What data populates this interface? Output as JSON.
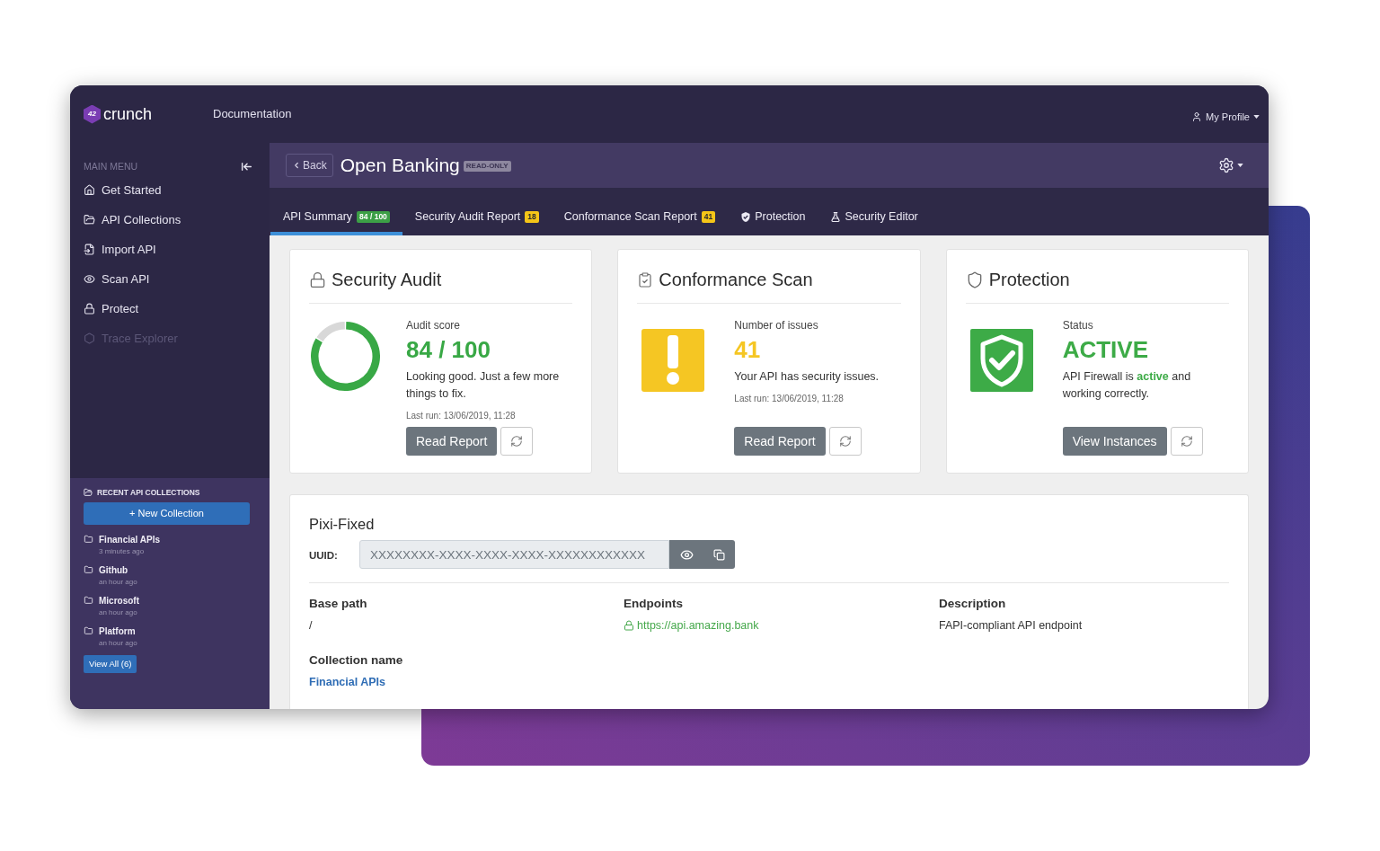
{
  "topbar": {
    "logo": {
      "mark": "42",
      "name": "crunch"
    },
    "nav_link": "Documentation",
    "profile": "My Profile"
  },
  "sidebar": {
    "menu_label": "MAIN MENU",
    "items": [
      {
        "label": "Get Started",
        "disabled": false
      },
      {
        "label": "API Collections",
        "disabled": false
      },
      {
        "label": "Import API",
        "disabled": false
      },
      {
        "label": "Scan API",
        "disabled": false
      },
      {
        "label": "Protect",
        "disabled": false
      },
      {
        "label": "Trace Explorer",
        "disabled": true
      }
    ],
    "recent": {
      "heading": "RECENT API COLLECTIONS",
      "new_button": "+ New Collection",
      "collections": [
        {
          "name": "Financial APIs",
          "time": "3 minutes ago"
        },
        {
          "name": "Github",
          "time": "an hour ago"
        },
        {
          "name": "Microsoft",
          "time": "an hour ago"
        },
        {
          "name": "Platform",
          "time": "an hour ago"
        }
      ],
      "view_all": "View All (6)"
    }
  },
  "header": {
    "back": "Back",
    "title": "Open Banking",
    "badge": "READ-ONLY"
  },
  "tabs": [
    {
      "kind": "badge",
      "label": "API Summary",
      "selected": true,
      "badge": {
        "text": "84 / 100",
        "color": "#3c9f46"
      }
    },
    {
      "kind": "badge",
      "label": "Security Audit Report",
      "selected": false,
      "badge": {
        "text": "18",
        "color": "#f5c518"
      }
    },
    {
      "kind": "badge",
      "label": "Conformance Scan Report",
      "selected": false,
      "badge": {
        "text": "41",
        "color": "#f5c518"
      }
    },
    {
      "kind": "icon",
      "label": "Protection",
      "selected": false
    },
    {
      "kind": "icon",
      "label": "Security Editor",
      "selected": false
    }
  ],
  "cards": [
    {
      "kind": "score",
      "title": "Security Audit",
      "chart_data": {
        "type": "donut",
        "values": [
          84,
          16
        ]
      },
      "label": "Audit score",
      "value": "84 / 100",
      "color": "#38a845",
      "description": "Looking good. Just a few more things to fix.",
      "last_run": "Last run: 13/06/2019, 11:28",
      "button": "Read Report"
    },
    {
      "kind": "issues",
      "title": "Conformance Scan",
      "label": "Number of issues",
      "value": "41",
      "color": "#f5c623",
      "description": "Your API has security issues.",
      "last_run": "Last run: 13/06/2019, 11:28",
      "button": "Read Report"
    },
    {
      "kind": "status",
      "title": "Protection",
      "label": "Status",
      "value": "ACTIVE",
      "color": "#3dab47",
      "description": "API Firewall is **active** and working correctly.",
      "button": "View Instances"
    }
  ],
  "detail": {
    "name": "Pixi-Fixed",
    "uuid_label": "UUID:",
    "uuid_value": "XXXXXXXX-XXXX-XXXX-XXXX-XXXXXXXXXXXX",
    "fields": [
      {
        "kind": "text",
        "label": "Base path",
        "value": "/"
      },
      {
        "kind": "secure_link",
        "label": "Endpoints",
        "value": "https://api.amazing.bank"
      },
      {
        "kind": "text",
        "label": "Description",
        "value": "FAPI-compliant API endpoint"
      },
      {
        "kind": "link",
        "label": "Collection name",
        "value": "Financial APIs"
      }
    ]
  }
}
